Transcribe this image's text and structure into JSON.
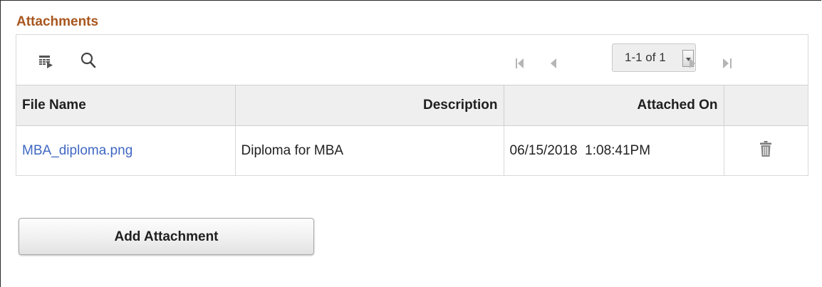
{
  "section": {
    "title": "Attachments"
  },
  "toolbar": {
    "icons": [
      "personalize-grid-icon",
      "search-icon",
      "first-page-icon",
      "previous-page-icon",
      "next-page-icon",
      "last-page-icon",
      "chevron-down-icon"
    ],
    "pager_label": "1-1 of 1"
  },
  "table": {
    "headers": {
      "file_name": "File Name",
      "description": "Description",
      "attached_on": "Attached On"
    },
    "rows": [
      {
        "file_name": "MBA_diploma.png",
        "description": "Diploma for MBA",
        "attached_on": "06/15/2018  1:08:41PM",
        "action_icon": "trash-icon"
      }
    ]
  },
  "actions": {
    "add_attachment_label": "Add Attachment"
  },
  "colors": {
    "title": "#a8561e",
    "link": "#3f67c2",
    "header_bg": "#efefef",
    "border": "#d0d0d0"
  }
}
